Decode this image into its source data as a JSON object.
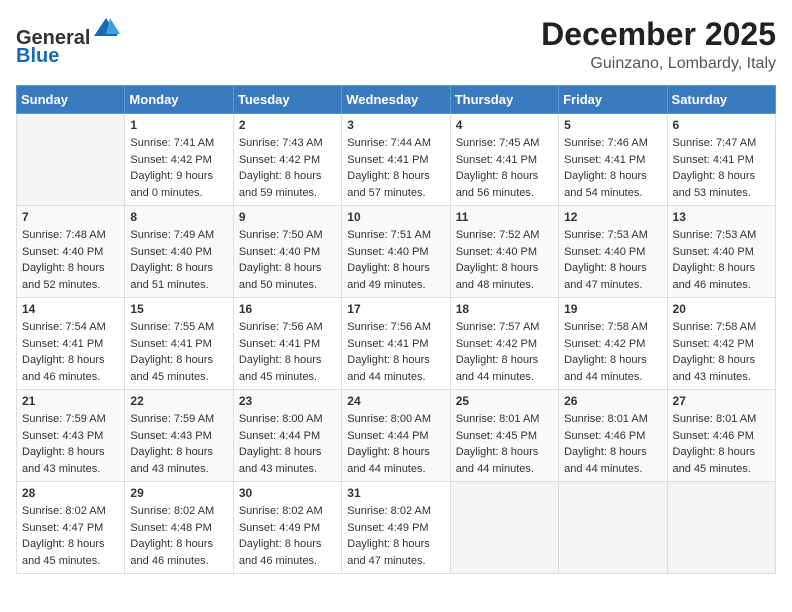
{
  "header": {
    "logo_general": "General",
    "logo_blue": "Blue",
    "month_title": "December 2025",
    "location": "Guinzano, Lombardy, Italy"
  },
  "weekdays": [
    "Sunday",
    "Monday",
    "Tuesday",
    "Wednesday",
    "Thursday",
    "Friday",
    "Saturday"
  ],
  "weeks": [
    [
      {
        "day": "",
        "content": ""
      },
      {
        "day": "1",
        "content": "Sunrise: 7:41 AM\nSunset: 4:42 PM\nDaylight: 9 hours\nand 0 minutes."
      },
      {
        "day": "2",
        "content": "Sunrise: 7:43 AM\nSunset: 4:42 PM\nDaylight: 8 hours\nand 59 minutes."
      },
      {
        "day": "3",
        "content": "Sunrise: 7:44 AM\nSunset: 4:41 PM\nDaylight: 8 hours\nand 57 minutes."
      },
      {
        "day": "4",
        "content": "Sunrise: 7:45 AM\nSunset: 4:41 PM\nDaylight: 8 hours\nand 56 minutes."
      },
      {
        "day": "5",
        "content": "Sunrise: 7:46 AM\nSunset: 4:41 PM\nDaylight: 8 hours\nand 54 minutes."
      },
      {
        "day": "6",
        "content": "Sunrise: 7:47 AM\nSunset: 4:41 PM\nDaylight: 8 hours\nand 53 minutes."
      }
    ],
    [
      {
        "day": "7",
        "content": "Sunrise: 7:48 AM\nSunset: 4:40 PM\nDaylight: 8 hours\nand 52 minutes."
      },
      {
        "day": "8",
        "content": "Sunrise: 7:49 AM\nSunset: 4:40 PM\nDaylight: 8 hours\nand 51 minutes."
      },
      {
        "day": "9",
        "content": "Sunrise: 7:50 AM\nSunset: 4:40 PM\nDaylight: 8 hours\nand 50 minutes."
      },
      {
        "day": "10",
        "content": "Sunrise: 7:51 AM\nSunset: 4:40 PM\nDaylight: 8 hours\nand 49 minutes."
      },
      {
        "day": "11",
        "content": "Sunrise: 7:52 AM\nSunset: 4:40 PM\nDaylight: 8 hours\nand 48 minutes."
      },
      {
        "day": "12",
        "content": "Sunrise: 7:53 AM\nSunset: 4:40 PM\nDaylight: 8 hours\nand 47 minutes."
      },
      {
        "day": "13",
        "content": "Sunrise: 7:53 AM\nSunset: 4:40 PM\nDaylight: 8 hours\nand 46 minutes."
      }
    ],
    [
      {
        "day": "14",
        "content": "Sunrise: 7:54 AM\nSunset: 4:41 PM\nDaylight: 8 hours\nand 46 minutes."
      },
      {
        "day": "15",
        "content": "Sunrise: 7:55 AM\nSunset: 4:41 PM\nDaylight: 8 hours\nand 45 minutes."
      },
      {
        "day": "16",
        "content": "Sunrise: 7:56 AM\nSunset: 4:41 PM\nDaylight: 8 hours\nand 45 minutes."
      },
      {
        "day": "17",
        "content": "Sunrise: 7:56 AM\nSunset: 4:41 PM\nDaylight: 8 hours\nand 44 minutes."
      },
      {
        "day": "18",
        "content": "Sunrise: 7:57 AM\nSunset: 4:42 PM\nDaylight: 8 hours\nand 44 minutes."
      },
      {
        "day": "19",
        "content": "Sunrise: 7:58 AM\nSunset: 4:42 PM\nDaylight: 8 hours\nand 44 minutes."
      },
      {
        "day": "20",
        "content": "Sunrise: 7:58 AM\nSunset: 4:42 PM\nDaylight: 8 hours\nand 43 minutes."
      }
    ],
    [
      {
        "day": "21",
        "content": "Sunrise: 7:59 AM\nSunset: 4:43 PM\nDaylight: 8 hours\nand 43 minutes."
      },
      {
        "day": "22",
        "content": "Sunrise: 7:59 AM\nSunset: 4:43 PM\nDaylight: 8 hours\nand 43 minutes."
      },
      {
        "day": "23",
        "content": "Sunrise: 8:00 AM\nSunset: 4:44 PM\nDaylight: 8 hours\nand 43 minutes."
      },
      {
        "day": "24",
        "content": "Sunrise: 8:00 AM\nSunset: 4:44 PM\nDaylight: 8 hours\nand 44 minutes."
      },
      {
        "day": "25",
        "content": "Sunrise: 8:01 AM\nSunset: 4:45 PM\nDaylight: 8 hours\nand 44 minutes."
      },
      {
        "day": "26",
        "content": "Sunrise: 8:01 AM\nSunset: 4:46 PM\nDaylight: 8 hours\nand 44 minutes."
      },
      {
        "day": "27",
        "content": "Sunrise: 8:01 AM\nSunset: 4:46 PM\nDaylight: 8 hours\nand 45 minutes."
      }
    ],
    [
      {
        "day": "28",
        "content": "Sunrise: 8:02 AM\nSunset: 4:47 PM\nDaylight: 8 hours\nand 45 minutes."
      },
      {
        "day": "29",
        "content": "Sunrise: 8:02 AM\nSunset: 4:48 PM\nDaylight: 8 hours\nand 46 minutes."
      },
      {
        "day": "30",
        "content": "Sunrise: 8:02 AM\nSunset: 4:49 PM\nDaylight: 8 hours\nand 46 minutes."
      },
      {
        "day": "31",
        "content": "Sunrise: 8:02 AM\nSunset: 4:49 PM\nDaylight: 8 hours\nand 47 minutes."
      },
      {
        "day": "",
        "content": ""
      },
      {
        "day": "",
        "content": ""
      },
      {
        "day": "",
        "content": ""
      }
    ]
  ]
}
